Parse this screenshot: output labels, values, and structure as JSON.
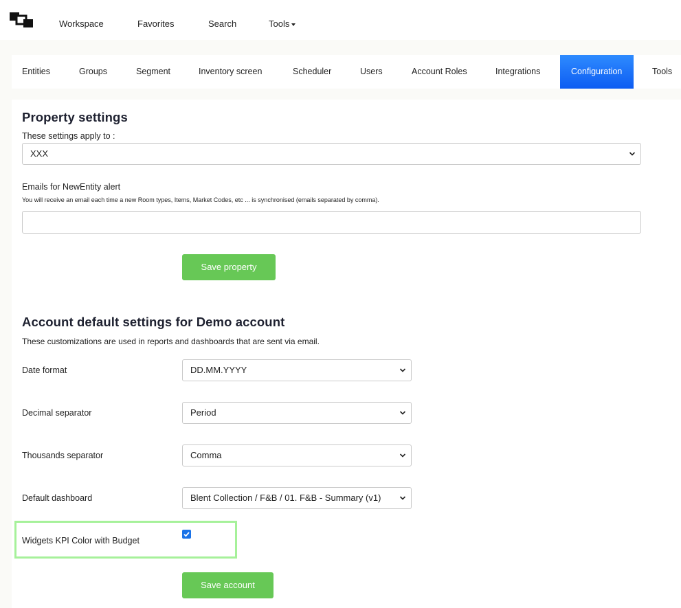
{
  "topnav": {
    "logo": "app-logo",
    "items": [
      "Workspace",
      "Favorites",
      "Search",
      "Tools"
    ]
  },
  "tabs": {
    "items": [
      "Entities",
      "Groups",
      "Segment",
      "Inventory screen",
      "Scheduler",
      "Users",
      "Account Roles",
      "Integrations",
      "Configuration",
      "Tools"
    ],
    "active": "Configuration",
    "active_color": "#1565f5"
  },
  "property": {
    "title": "Property settings",
    "applies_label": "These settings apply to :",
    "applies_value": "XXX",
    "emails_label": "Emails for NewEntity alert",
    "emails_help": "You will receive an email each time a new Room types, Items, Market Codes, etc ... is synchronised (emails separated by comma).",
    "emails_value": "",
    "save_label": "Save property"
  },
  "account": {
    "title": "Account default settings for Demo account",
    "subtitle": "These customizations are used in reports and dashboards that are sent via email.",
    "date_format_label": "Date format",
    "date_format_value": "DD.MM.YYYY",
    "decimal_label": "Decimal separator",
    "decimal_value": "Period",
    "thousands_label": "Thousands separator",
    "thousands_value": "Comma",
    "dashboard_label": "Default dashboard",
    "dashboard_value": "Blent Collection / F&B / 01. F&B - Summary (v1)",
    "widgets_label": "Widgets KPI Color with Budget",
    "widgets_checked": true,
    "save_label": "Save account"
  },
  "colors": {
    "button_green": "#67c856",
    "highlight_green": "#a6f19a",
    "checkbox_blue": "#1a73e8"
  }
}
